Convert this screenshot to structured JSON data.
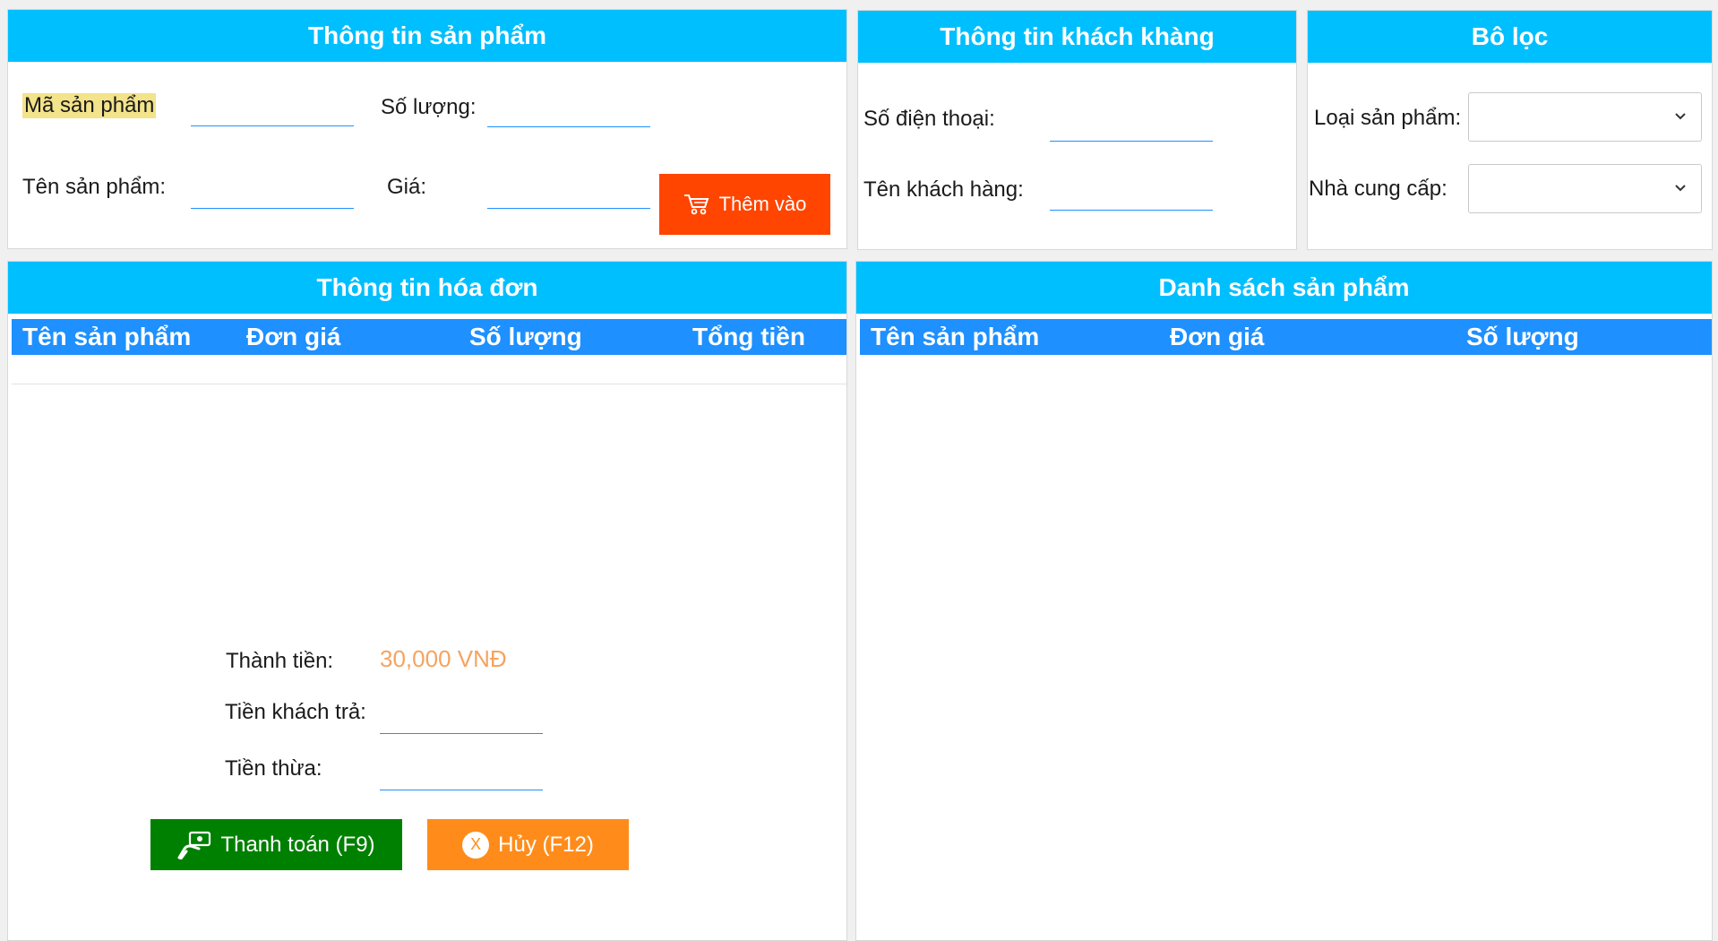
{
  "product_info": {
    "title": "Thông tin sản phẩm",
    "code_label": "Mã sản phẩm",
    "quantity_label": "Số lượng:",
    "name_label": "Tên sản phẩm:",
    "price_label": "Giá:",
    "add_button": "Thêm vào"
  },
  "customer_info": {
    "title": "Thông tin khách khàng",
    "phone_label": "Số điện thoại:",
    "name_label": "Tên khách hàng:"
  },
  "filter": {
    "title": "Bô lọc",
    "category_label": "Loại sản phẩm:",
    "supplier_label": "Nhà cung cấp:"
  },
  "invoice": {
    "title": "Thông tin hóa đơn",
    "columns": [
      "Tên sản phẩm",
      "Đơn giá",
      "Số lượng",
      "Tổng tiền"
    ],
    "total_label": "Thành tiền:",
    "total_value": "30,000 VNĐ",
    "paid_label": "Tiền khách trả:",
    "change_label": "Tiền thừa:",
    "pay_button": "Thanh toán (F9)",
    "cancel_button": "Hủy (F12)",
    "cancel_icon_text": "X"
  },
  "product_list": {
    "title": "Danh sách sản phẩm",
    "columns": [
      "Tên sản phẩm",
      "Đơn giá",
      "Số lượng"
    ]
  },
  "colors": {
    "header": "#00bfff",
    "table_header": "#1e90ff",
    "add_button": "#ff4500",
    "pay_button": "#008000",
    "cancel_button": "#ff8c1a",
    "total_value": "#f4a460"
  }
}
